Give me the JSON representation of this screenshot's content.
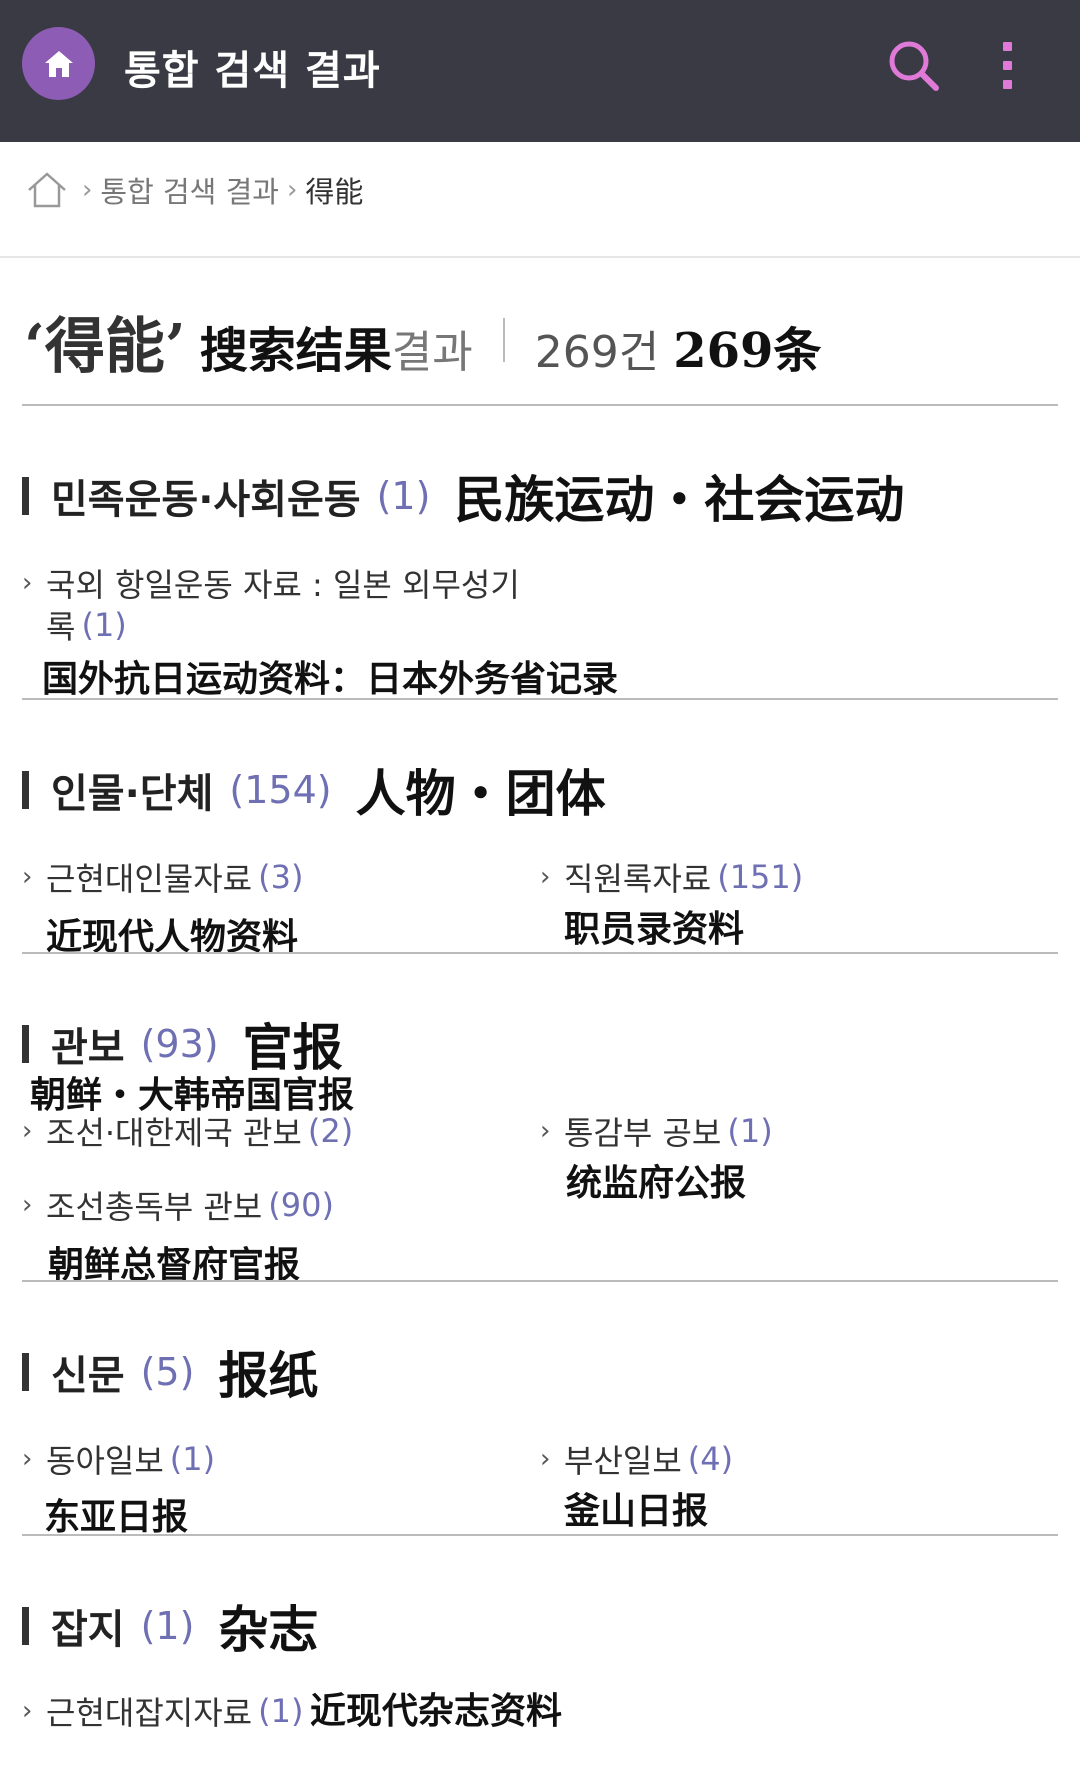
{
  "header": {
    "title": "통합 검색 결과",
    "home_icon": "home-icon",
    "search_icon": "search-icon",
    "more_icon": "more-vertical-icon",
    "accent_color": "#8d5cb4",
    "icon_color": "#e07ad8"
  },
  "breadcrumb": {
    "items": [
      "통합 검색 결과"
    ],
    "current": "得能"
  },
  "result": {
    "keyword": "‘得能’",
    "label_cn": "搜索结果",
    "label_kr": "결과",
    "count_kr": "269건",
    "count_cn": "269条"
  },
  "sections": [
    {
      "title_kr": "민족운동·사회운동",
      "count": "(1)",
      "title_cn": "民族运动・社会运动",
      "items": [
        {
          "label_kr_line1": "국외 항일운동 자료 : 일본 외무성기",
          "label_kr_line2": "록",
          "count": "(1)",
          "label_cn": "国外抗日运动资料：日本外务省记录"
        }
      ]
    },
    {
      "title_kr": "인물·단체",
      "count": "(154)",
      "title_cn": "人物・团体",
      "items": [
        {
          "label_kr": "근현대인물자료",
          "count": "(3)",
          "label_cn": "近现代人物资料"
        },
        {
          "label_kr": "직원록자료",
          "count": "(151)",
          "label_cn": "职员录资料"
        }
      ]
    },
    {
      "title_kr": "관보",
      "count": "(93)",
      "title_cn": "官报",
      "subtitle_cn": "朝鲜・大韩帝国官报",
      "items": [
        {
          "label_kr": "조선·대한제국 관보",
          "count": "(2)"
        },
        {
          "label_kr": "통감부 공보",
          "count": "(1)",
          "label_cn": "统监府公报"
        },
        {
          "label_kr": "조선총독부 관보",
          "count": "(90)",
          "label_cn": "朝鲜总督府官报"
        }
      ]
    },
    {
      "title_kr": "신문",
      "count": "(5)",
      "title_cn": "报纸",
      "items": [
        {
          "label_kr": "동아일보",
          "count": "(1)",
          "label_cn": "东亚日报"
        },
        {
          "label_kr": "부산일보",
          "count": "(4)",
          "label_cn": "釜山日报"
        }
      ]
    },
    {
      "title_kr": "잡지",
      "count": "(1)",
      "title_cn": "杂志",
      "items": [
        {
          "label_kr": "근현대잡지자료",
          "count": "(1)",
          "label_cn": "近现代杂志资料"
        }
      ]
    }
  ]
}
